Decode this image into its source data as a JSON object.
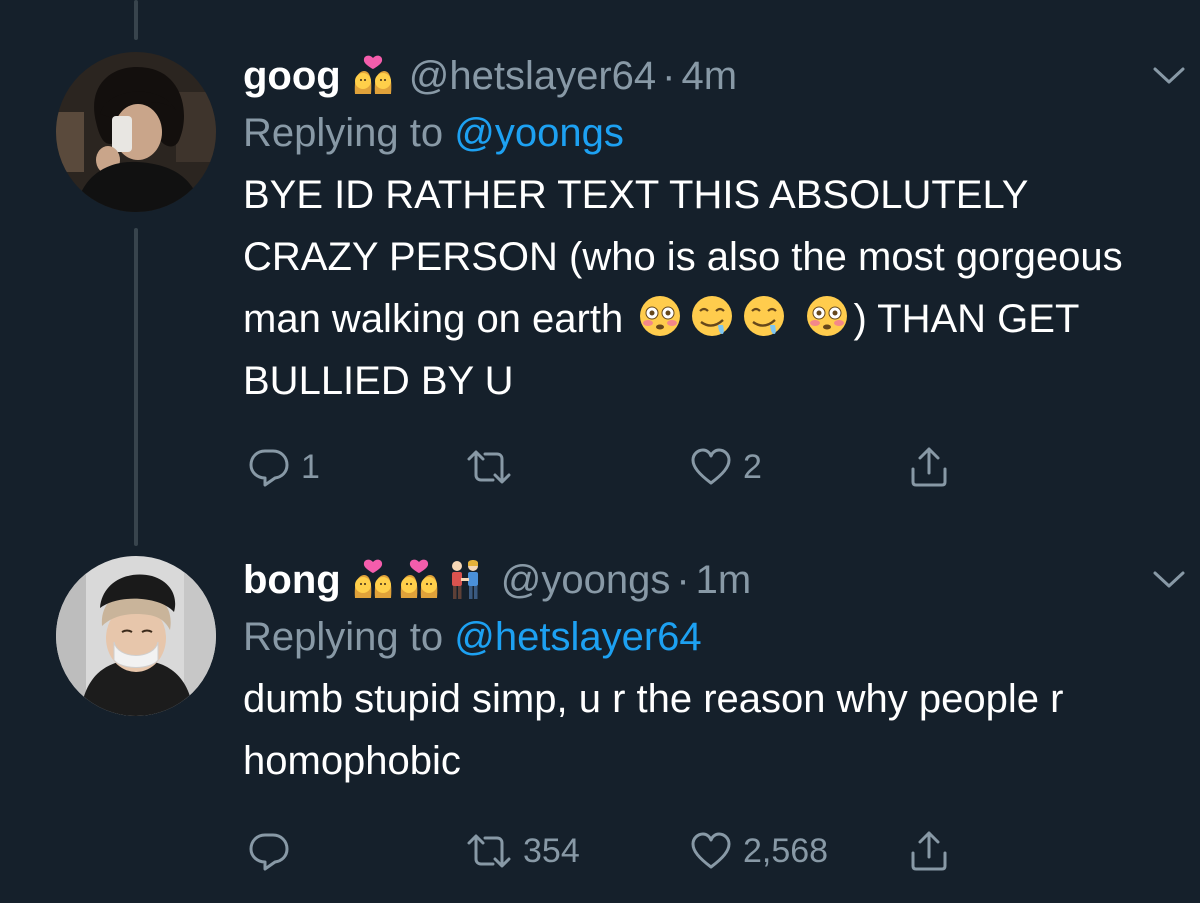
{
  "colors": {
    "background": "#15202b",
    "primary_text": "#ffffff",
    "secondary_text": "#8899a6",
    "link": "#1da1f2",
    "thread_line": "#38444d"
  },
  "tweets": [
    {
      "display_name": "goog",
      "name_emojis": [
        "couple-with-heart-woman-woman-emoji"
      ],
      "handle": "@hetslayer64",
      "separator": "·",
      "time": "4m",
      "replying_prefix": "Replying to",
      "replying_to": "@yoongs",
      "text_part_1": "BYE ID RATHER TEXT THIS ABSOLUTELY CRAZY PERSON (who is also the most gorgeous man walking on earth",
      "text_emojis_1": [
        "flushed-face-emoji",
        "drooling-face-emoji",
        "drooling-face-emoji"
      ],
      "text_emojis_2": [
        "flushed-face-emoji"
      ],
      "text_part_2": ") THAN GET BULLIED BY U",
      "reply_count": "1",
      "retweet_count": "",
      "like_count": "2",
      "icons": [
        "reply-icon",
        "retweet-icon",
        "like-icon",
        "share-icon",
        "chevron-down-icon"
      ]
    },
    {
      "display_name": "bong",
      "name_emojis": [
        "couple-with-heart-woman-woman-emoji",
        "couple-with-heart-woman-woman-emoji",
        "man-and-woman-holding-hands-emoji"
      ],
      "handle": "@yoongs",
      "separator": "·",
      "time": "1m",
      "replying_prefix": "Replying to",
      "replying_to": "@hetslayer64",
      "text": "dumb stupid simp, u r the reason why people r homophobic",
      "reply_count": "",
      "retweet_count": "354",
      "like_count": "2,568",
      "icons": [
        "reply-icon",
        "retweet-icon",
        "like-icon",
        "share-icon",
        "chevron-down-icon"
      ]
    }
  ]
}
